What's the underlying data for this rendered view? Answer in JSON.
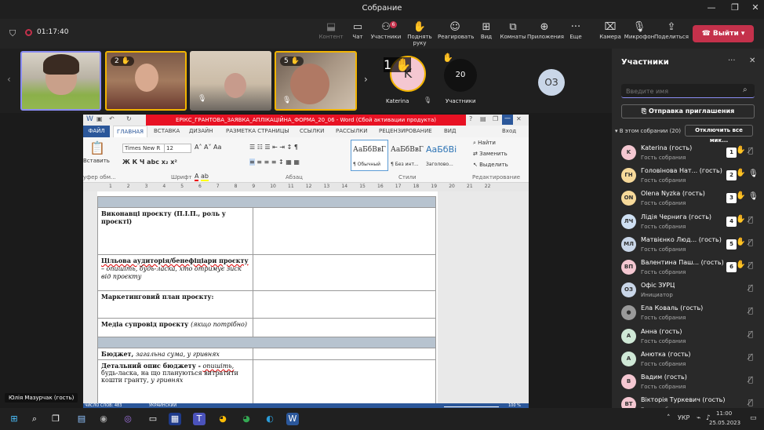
{
  "window": {
    "title": "Собрание"
  },
  "toolbar": {
    "timer": "01:17:40",
    "buttons": [
      {
        "label": "Контент",
        "icon": "share-content-icon"
      },
      {
        "label": "Чат",
        "icon": "chat-icon"
      },
      {
        "label": "Участники",
        "icon": "people-icon",
        "badge": "6"
      },
      {
        "label": "Поднять руку",
        "icon": "raise-hand-icon"
      },
      {
        "label": "Реагировать",
        "icon": "smile-icon"
      },
      {
        "label": "Вид",
        "icon": "grid-view-icon"
      },
      {
        "label": "Комнаты",
        "icon": "breakout-rooms-icon"
      },
      {
        "label": "Приложения",
        "icon": "apps-icon"
      },
      {
        "label": "Еще",
        "icon": "more-icon"
      },
      {
        "label": "Камера",
        "icon": "camera-off-icon"
      },
      {
        "label": "Микрофон",
        "icon": "mic-off-icon"
      },
      {
        "label": "Поделиться",
        "icon": "share-icon"
      }
    ],
    "leave_label": "Выйти"
  },
  "video_strip": {
    "tiles": [
      {
        "hand": ""
      },
      {
        "hand": "2 ✋"
      },
      {
        "hand": ""
      },
      {
        "hand": "5 ✋"
      }
    ],
    "katerina": {
      "initial": "K",
      "hand": "1 ✋",
      "name": "Katerina"
    },
    "more_count": "20",
    "more_label": "Участники",
    "extra_initials": "ОЗ"
  },
  "presenter_label": "Юлія Мазурчак (гость)",
  "word": {
    "title": "ЕРІКС_ГРАНТОВА_ЗАЯВКА_АПЛІКАЦІЙНА_ФОРМА_20_06 -  Word (Сбой активации продукта)",
    "tabs": [
      "ФАЙЛ",
      "ГЛАВНАЯ",
      "ВСТАВКА",
      "ДИЗАЙН",
      "РАЗМЕТКА СТРАНИЦЫ",
      "ССЫЛКИ",
      "РАССЫЛКИ",
      "РЕЦЕНЗИРОВАНИЕ",
      "ВИД",
      "Вход"
    ],
    "ribbon": {
      "paste": "Вставить",
      "clipboard": "уфер обм...",
      "font_name": "Times New R",
      "font_size": "12",
      "font_group": "Шрифт",
      "para_group": "Абзац",
      "styles": [
        "АаБбВвГ",
        "АаБбВвГ",
        "АаБбВі"
      ],
      "style_labels": [
        "¶ Обычный",
        "¶ Без инт...",
        "Заголово..."
      ],
      "styles_group": "Стили",
      "find": "Найти",
      "replace": "Заменить",
      "select": "Выделить",
      "edit_group": "Редактирование"
    },
    "ruler": [
      "1",
      "2",
      "3",
      "4",
      "5",
      "6",
      "7",
      "8",
      "9",
      "10",
      "11",
      "12",
      "13",
      "14",
      "15",
      "16",
      "17",
      "18",
      "19",
      "20",
      "21",
      "22"
    ],
    "rows": [
      {
        "a": "Виконавці проєкту (П.І.П., роль у проєкті)"
      },
      {
        "a": "Цільова аудиторія/бенефіціари проєкту",
        "b": "– опишіть, будь-ласка, хто отримує зиск від проєкту"
      },
      {
        "a": "Маркетинговий план проєкту:"
      },
      {
        "a": "Медіа супровід проєкту",
        "b": "(якщо потрібно)"
      },
      {
        "a": "Бюджет,",
        "b": "загальна сума, у гривнях"
      },
      {
        "a": "Детальний опис бюджету -",
        "b": "опишіть,",
        "c": "будь-ласка, на що плануються витратити кошти гранту,",
        "d": "у гривнях"
      }
    ],
    "status": {
      "words": "ЧИСЛО СЛОВ: 483",
      "lang": "УКРАИНСКИЙ",
      "zoom": "100 %"
    }
  },
  "panel": {
    "title": "Участники",
    "search_placeholder": "Введите имя",
    "invite": "Отправка приглашения",
    "section": "В этом собрании (20)",
    "mute_all": "Отключить все мик...",
    "participants": [
      {
        "initials": "K",
        "name": "Katerina (гость)",
        "role": "Гость собрания",
        "num": "1",
        "color": "#f4c7d1",
        "mic": "off"
      },
      {
        "initials": "ГН",
        "name": "Головінова Нат... (гость)",
        "role": "Гость собрания",
        "num": "2",
        "color": "#f6d99a",
        "mic": "on"
      },
      {
        "initials": "ON",
        "name": "Olena Nyzka (гость)",
        "role": "Гость собрания",
        "num": "3",
        "color": "#f6d99a",
        "mic": "on"
      },
      {
        "initials": "ЛЧ",
        "name": "Лідія Чернига (гость)",
        "role": "Гость собрания",
        "num": "4",
        "color": "#cfe0f3",
        "mic": "off"
      },
      {
        "initials": "МЛ",
        "name": "Матвієнко Люд... (гость)",
        "role": "Гость собрания",
        "num": "5",
        "color": "#c9d6e8",
        "mic": "off"
      },
      {
        "initials": "ВП",
        "name": "Валентина Паш... (гость)",
        "role": "Гость собрания",
        "num": "6",
        "color": "#f4c7d1",
        "mic": "off"
      },
      {
        "initials": "ОЗ",
        "name": "Офіс ЗУРЦ",
        "role": "Инициатор",
        "num": "",
        "color": "#c9d6e8",
        "mic": "off"
      },
      {
        "initials": "●",
        "name": "Ела Коваль (гость)",
        "role": "Гость собрания",
        "num": "",
        "color": "#9a9a9a",
        "mic": "off"
      },
      {
        "initials": "А",
        "name": "Анна (гость)",
        "role": "Гость собрания",
        "num": "",
        "color": "#cfe8d6",
        "mic": "off"
      },
      {
        "initials": "А",
        "name": "Анютка (гость)",
        "role": "Гость собрания",
        "num": "",
        "color": "#cfe8d6",
        "mic": "off"
      },
      {
        "initials": "В",
        "name": "Вадим (гость)",
        "role": "Гость собрания",
        "num": "",
        "color": "#f4c7d1",
        "mic": "off"
      },
      {
        "initials": "ВТ",
        "name": "Вікторія Туркевич (гость)",
        "role": "Гость собрания",
        "num": "",
        "color": "#f4c7d1",
        "mic": "off"
      }
    ]
  },
  "taskbar": {
    "lang": "УКР",
    "time": "11:00",
    "date": "25.05.2023"
  }
}
